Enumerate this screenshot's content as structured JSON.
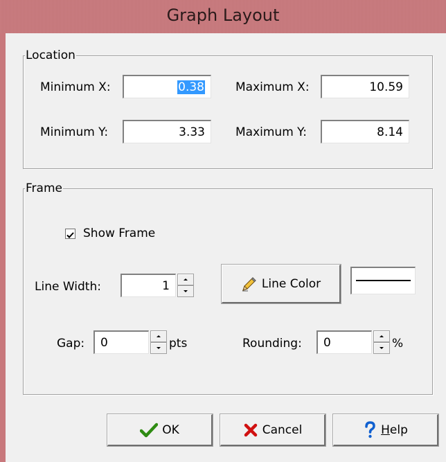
{
  "window": {
    "title": "Graph Layout"
  },
  "location": {
    "legend": "Location",
    "min_x_label": "Minimum X:",
    "min_x_value": "0.38",
    "max_x_label": "Maximum X:",
    "max_x_value": "10.59",
    "min_y_label": "Minimum Y:",
    "min_y_value": "3.33",
    "max_y_label": "Maximum Y:",
    "max_y_value": "8.14"
  },
  "frame": {
    "legend": "Frame",
    "show_frame_label": "Show Frame",
    "show_frame_checked": true,
    "line_width_label": "Line Width:",
    "line_width_value": "1",
    "line_color_label": "Line Color",
    "line_color": "#000000",
    "gap_label": "Gap:",
    "gap_value": "0",
    "gap_unit": "pts",
    "rounding_label": "Rounding:",
    "rounding_value": "0",
    "rounding_unit": "%"
  },
  "buttons": {
    "ok": "OK",
    "cancel": "Cancel",
    "help_mnemonic": "H",
    "help_rest": "elp"
  },
  "colors": {
    "titlebar": "#c8787c",
    "selection": "#3399ff",
    "ok_check": "#2e8b12",
    "cancel_x": "#d01010",
    "help_mark": "#1060d0"
  },
  "icons": {
    "line_color_button": "pencil-icon",
    "ok_button": "checkmark-icon",
    "cancel_button": "x-icon",
    "help_button": "question-mark-icon"
  }
}
